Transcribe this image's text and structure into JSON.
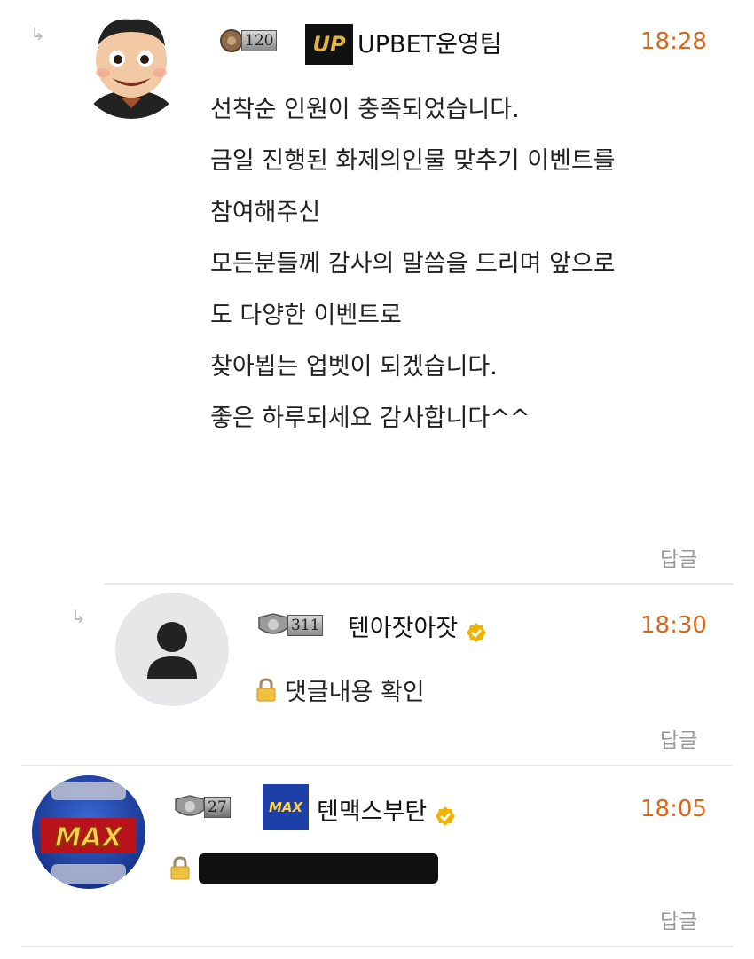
{
  "comments": [
    {
      "level": "120",
      "author": "UPBET운영팀",
      "time": "18:28",
      "lines": [
        "선착순 인원이 충족되었습니다.",
        "",
        "금일 진행된 화제의인물 맞추기 이벤트를",
        "참여해주신",
        "모든분들께 감사의 말씀을 드리며 앞으로",
        "도 다양한 이벤트로",
        "찾아뵙는 업벳이 되겠습니다.",
        "",
        "좋은 하루되세요 감사합니다^^"
      ],
      "reply_label": "답글",
      "emblem_text": "UP"
    },
    {
      "level": "311",
      "author": "텐아잣아잣",
      "time": "18:30",
      "body": "댓글내용 확인",
      "reply_label": "답글"
    },
    {
      "level": "27",
      "author": "텐맥스부탄",
      "time": "18:05",
      "reply_label": "답글",
      "avatar_text": "MAX",
      "emblem_text": "MAX"
    }
  ],
  "colors": {
    "time": "#d2691e",
    "verified": "#f0b400",
    "divider": "#e6e6e6"
  }
}
